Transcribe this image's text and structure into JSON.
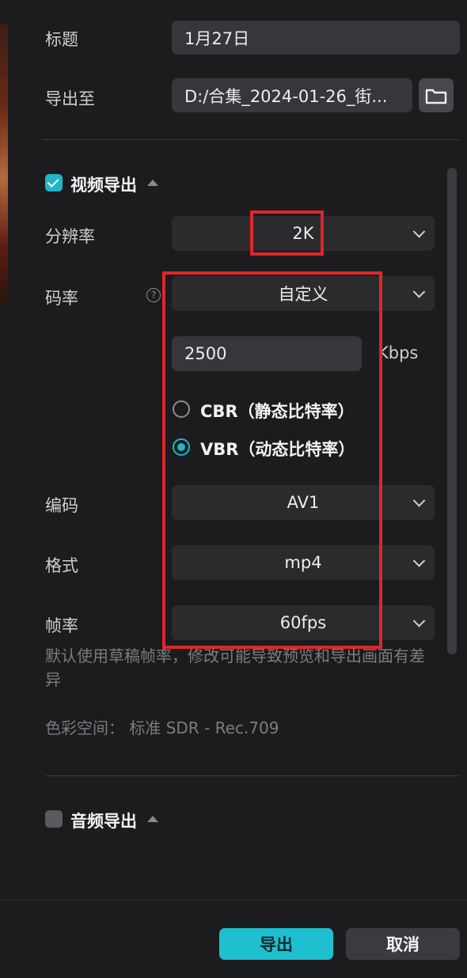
{
  "title_field": {
    "label": "标题",
    "value": "1月27日"
  },
  "export_to": {
    "label": "导出至",
    "value": "D:/合集_2024-01-26_街..."
  },
  "video_section": {
    "title": "视频导出",
    "checked": true,
    "resolution": {
      "label": "分辨率",
      "value": "2K"
    },
    "bitrate": {
      "label": "码率",
      "help": "?",
      "value": "自定义",
      "custom_value": "2500",
      "unit": "Kbps"
    },
    "rate_modes": [
      {
        "label": "CBR（静态比特率）",
        "selected": false
      },
      {
        "label": "VBR（动态比特率）",
        "selected": true
      }
    ],
    "codec": {
      "label": "编码",
      "value": "AV1"
    },
    "format": {
      "label": "格式",
      "value": "mp4"
    },
    "framerate": {
      "label": "帧率",
      "value": "60fps"
    },
    "framerate_hint": "默认使用草稿帧率，修改可能导致预览和导出画面有差异",
    "color_space": "色彩空间：  标准 SDR - Rec.709"
  },
  "audio_section": {
    "title": "音频导出",
    "checked": false
  },
  "buttons": {
    "export": "导出",
    "cancel": "取消"
  },
  "colors": {
    "accent": "#1ec0cf",
    "highlight": "#e0262a",
    "background": "#1c1c1e"
  }
}
